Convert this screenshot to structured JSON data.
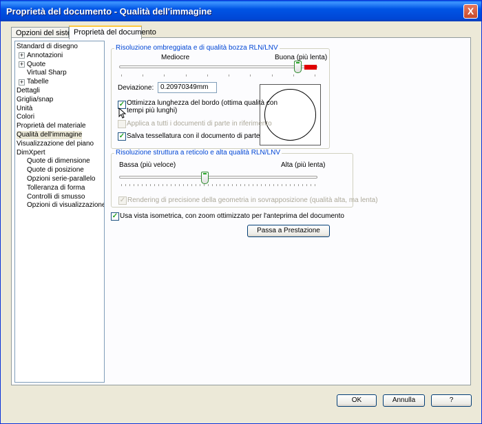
{
  "window": {
    "title": "Proprietà del documento - Qualità dell'immagine",
    "close_glyph": "X"
  },
  "tabs": [
    "Opzioni del sistema",
    "Proprietà del documento"
  ],
  "tree": [
    {
      "label": "Standard di disegno",
      "level": 0
    },
    {
      "label": "Annotazioni",
      "level": 1,
      "expander": "+"
    },
    {
      "label": "Quote",
      "level": 1,
      "expander": "+"
    },
    {
      "label": "Virtual Sharp",
      "level": 1
    },
    {
      "label": "Tabelle",
      "level": 1,
      "expander": "+"
    },
    {
      "label": "Dettagli",
      "level": 0
    },
    {
      "label": "Griglia/snap",
      "level": 0
    },
    {
      "label": "Unità",
      "level": 0
    },
    {
      "label": "Colori",
      "level": 0
    },
    {
      "label": "Proprietà del materiale",
      "level": 0
    },
    {
      "label": "Qualità dell'immagine",
      "level": 0,
      "selected": true
    },
    {
      "label": "Visualizzazione del piano",
      "level": 0
    },
    {
      "label": "DimXpert",
      "level": 0
    },
    {
      "label": "Quote di dimensione",
      "level": 1
    },
    {
      "label": "Quote di posizione",
      "level": 1
    },
    {
      "label": "Opzioni serie-parallelo",
      "level": 1
    },
    {
      "label": "Tolleranza di forma",
      "level": 1
    },
    {
      "label": "Controlli di smusso",
      "level": 1
    },
    {
      "label": "Opzioni di visualizzazione",
      "level": 1
    }
  ],
  "shaded": {
    "group_label": "Risoluzione ombreggiata e di qualità bozza RLN/LNV",
    "low_label": "Mediocre",
    "high_label": "Buona (più lenta)",
    "slider_value": 0.9,
    "deviation_label": "Deviazione:",
    "deviation_value": "0.20970349mm",
    "optimize_label_1": "Ottimizza lunghezza del bordo (ottima qualità con",
    "optimize_label_2": "tempi più lunghi)",
    "optimize_checked": true,
    "apply_all_label": "Applica a tutti i documenti di parte in riferimento",
    "apply_all_checked": false,
    "save_tess_label": "Salva tessellatura con il documento di parte",
    "save_tess_checked": true
  },
  "wireframe": {
    "group_label": "Risoluzione struttura a reticolo e alta qualità RLN/LNV",
    "low_label": "Bassa (più veloce)",
    "high_label": "Alta (più lenta)",
    "slider_value": 0.43,
    "precision_label": "Rendering di precisione della geometria in sovrapposizione (qualità alta, ma lenta)",
    "precision_checked": true
  },
  "iso_label": "Usa vista isometrica, con zoom ottimizzato per l'anteprima del documento",
  "iso_checked": true,
  "performance_button": "Passa a Prestazione",
  "check_glyph": "✓",
  "buttons": {
    "ok": "OK",
    "cancel": "Annulla",
    "help": "?"
  },
  "colors": {
    "title_bar": "#0055e5",
    "active_tab_accent": "#ffc83c",
    "group_label": "#0046d5",
    "slider_max_marker": "#e00000"
  }
}
